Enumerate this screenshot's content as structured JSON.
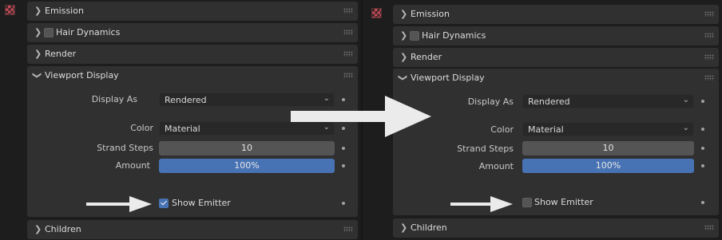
{
  "panels": [
    {
      "sections": {
        "emission": "Emission",
        "hair_dynamics": "Hair Dynamics",
        "render": "Render",
        "viewport_display": "Viewport Display",
        "children": "Children"
      },
      "viewport_display": {
        "display_as_label": "Display As",
        "display_as_value": "Rendered",
        "color_label": "Color",
        "color_value": "Material",
        "strand_steps_label": "Strand Steps",
        "strand_steps_value": "10",
        "amount_label": "Amount",
        "amount_value": "100%",
        "amount_fraction": 1.0,
        "show_emitter_label": "Show Emitter",
        "show_emitter_checked": true
      }
    },
    {
      "sections": {
        "emission": "Emission",
        "hair_dynamics": "Hair Dynamics",
        "render": "Render",
        "viewport_display": "Viewport Display",
        "children": "Children"
      },
      "viewport_display": {
        "display_as_label": "Display As",
        "display_as_value": "Rendered",
        "color_label": "Color",
        "color_value": "Material",
        "strand_steps_label": "Strand Steps",
        "strand_steps_value": "10",
        "amount_label": "Amount",
        "amount_value": "100%",
        "amount_fraction": 1.0,
        "show_emitter_label": "Show Emitter",
        "show_emitter_checked": false
      }
    }
  ],
  "colors": {
    "accent_blue": "#4772b3",
    "panel_bg": "#303030",
    "field_bg": "#545454",
    "arrow_white": "#ebebeb"
  },
  "icons": {
    "texture_checker": "checker-icon",
    "expand": "chevron-right-icon",
    "collapse": "chevron-down-icon",
    "grip": "drag-grip-icon",
    "dropdown": "chevron-down-icon"
  }
}
